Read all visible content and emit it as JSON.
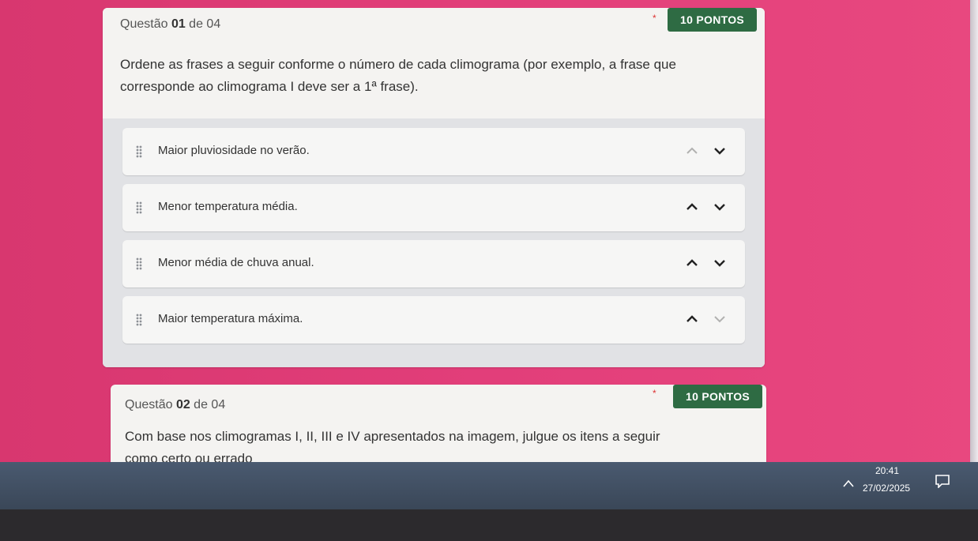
{
  "question1": {
    "number_prefix": "Questão ",
    "number": "01",
    "number_suffix": " de 04",
    "required_mark": "*",
    "points": "10 PONTOS",
    "text_line1": "Ordene as frases a seguir conforme o número de cada climograma (por exemplo, a frase que",
    "text_line2": "corresponde ao climograma I deve ser a 1ª frase).",
    "items": [
      {
        "label": "Maior pluviosidade no verão."
      },
      {
        "label": "Menor temperatura média."
      },
      {
        "label": "Menor média de chuva anual."
      },
      {
        "label": "Maior temperatura máxima."
      }
    ]
  },
  "question2": {
    "number_prefix": "Questão ",
    "number": "02",
    "number_suffix": " de 04",
    "required_mark": "*",
    "points": "10 PONTOS",
    "text_line1": "Com base nos climogramas I, II, III e IV apresentados na imagem, julgue os itens a seguir",
    "text_line2": "como certo ou errado"
  },
  "taskbar": {
    "time": "20:41",
    "date": "27/02/2025"
  },
  "icons": {
    "drag": "drag-handle-icon",
    "up": "chevron-up-icon",
    "down": "chevron-down-icon",
    "notification": "notification-icon"
  }
}
